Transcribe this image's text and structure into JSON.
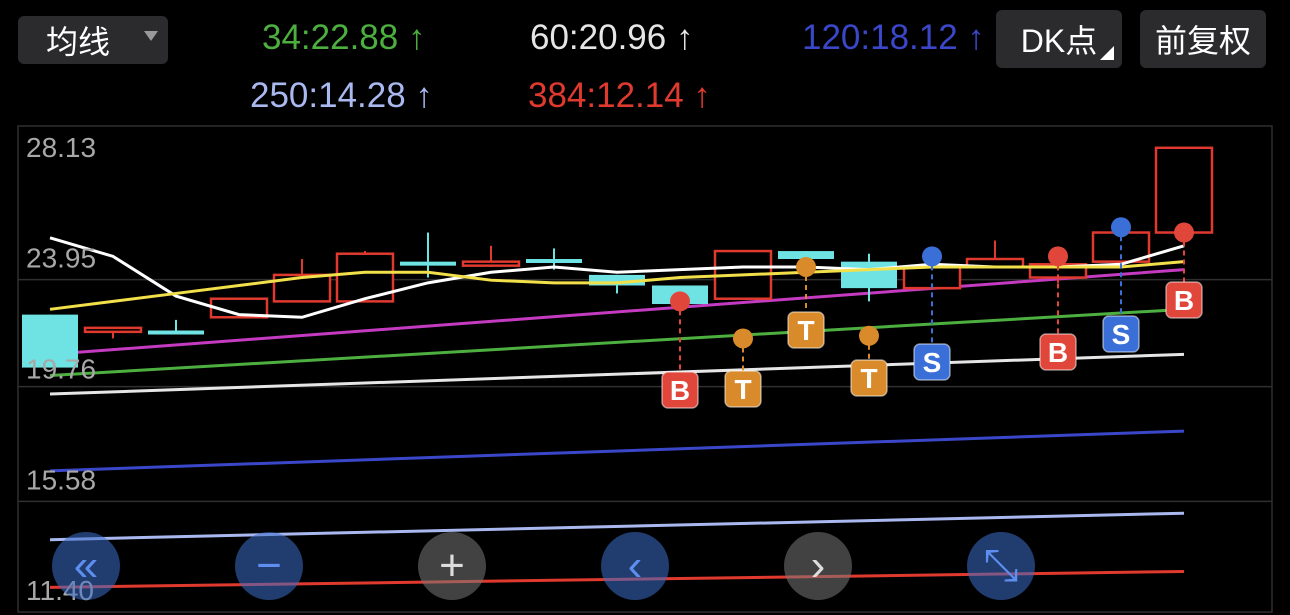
{
  "header": {
    "ma_select_label": "均线",
    "dk_button_label": "DK点",
    "adjust_button_label": "前复权"
  },
  "ma_labels": [
    {
      "text": "34:22.88",
      "arrow": "↑",
      "color": "#4caf3f"
    },
    {
      "text": "60:20.96",
      "arrow": "↑",
      "color": "#e6e6e6"
    },
    {
      "text": "120:18.12",
      "arrow": "↑",
      "color": "#3a47c9"
    },
    {
      "text": "250:14.28",
      "arrow": "↑",
      "color": "#a9b8ef"
    },
    {
      "text": "384:12.14",
      "arrow": "↑",
      "color": "#e03a2f"
    }
  ],
  "chart_data": {
    "type": "candlestick",
    "y_ticks": [
      "28.13",
      "23.95",
      "19.76",
      "15.58",
      "11.40"
    ],
    "ylim": [
      11.4,
      28.13
    ],
    "colors": {
      "up": "#e03a2f",
      "down": "#6fe3e3",
      "grid": "#2f2f2f"
    },
    "candles": [
      {
        "open": 21.8,
        "high": 21.8,
        "low": 19.8,
        "close": 19.8,
        "dir": "down"
      },
      {
        "open": 21.2,
        "high": 21.3,
        "low": 20.9,
        "close": 21.3,
        "dir": "up"
      },
      {
        "open": 21.2,
        "high": 21.6,
        "low": 21.2,
        "close": 21.2,
        "dir": "down"
      },
      {
        "open": 21.7,
        "high": 22.2,
        "low": 21.7,
        "close": 22.4,
        "dir": "up"
      },
      {
        "open": 22.3,
        "high": 23.9,
        "low": 22.3,
        "close": 23.3,
        "dir": "up"
      },
      {
        "open": 22.3,
        "high": 24.2,
        "low": 22.3,
        "close": 24.1,
        "dir": "up"
      },
      {
        "open": 23.8,
        "high": 24.9,
        "low": 23.2,
        "close": 23.8,
        "dir": "down"
      },
      {
        "open": 23.8,
        "high": 24.4,
        "low": 23.6,
        "close": 23.8,
        "dir": "up"
      },
      {
        "open": 23.9,
        "high": 24.3,
        "low": 23.5,
        "close": 23.8,
        "dir": "down"
      },
      {
        "open": 23.3,
        "high": 23.3,
        "low": 22.6,
        "close": 22.9,
        "dir": "down"
      },
      {
        "open": 22.9,
        "high": 22.9,
        "low": 22.0,
        "close": 22.2,
        "dir": "down"
      },
      {
        "open": 22.4,
        "high": 24.2,
        "low": 22.4,
        "close": 24.2,
        "dir": "up"
      },
      {
        "open": 24.2,
        "high": 24.2,
        "low": 23.8,
        "close": 23.9,
        "dir": "down"
      },
      {
        "open": 23.8,
        "high": 24.1,
        "low": 22.3,
        "close": 22.8,
        "dir": "down"
      },
      {
        "open": 22.8,
        "high": 23.6,
        "low": 22.8,
        "close": 23.6,
        "dir": "up"
      },
      {
        "open": 23.6,
        "high": 24.6,
        "low": 23.6,
        "close": 23.9,
        "dir": "up"
      },
      {
        "open": 23.2,
        "high": 24.1,
        "low": 23.0,
        "close": 23.7,
        "dir": "up"
      },
      {
        "open": 23.8,
        "high": 25.2,
        "low": 23.8,
        "close": 24.9,
        "dir": "up"
      },
      {
        "open": 24.9,
        "high": 28.1,
        "low": 24.9,
        "close": 28.1,
        "dir": "up"
      }
    ],
    "ma_series": [
      {
        "name": "white",
        "color": "#ffffff",
        "values": [
          24.7,
          24.0,
          22.5,
          21.8,
          21.7,
          22.4,
          23.0,
          23.4,
          23.6,
          23.4,
          23.5,
          23.6,
          23.6,
          23.5,
          23.7,
          23.6,
          23.6,
          23.7,
          24.4
        ]
      },
      {
        "name": "yellow",
        "color": "#f2e04a",
        "values": [
          22.0,
          22.3,
          22.6,
          22.9,
          23.2,
          23.4,
          23.4,
          23.1,
          23.0,
          23.0,
          23.2,
          23.3,
          23.4,
          23.5,
          23.6,
          23.6,
          23.6,
          23.6,
          23.8
        ]
      }
    ],
    "line_series": [
      {
        "name": "magenta",
        "color": "#c43ac0",
        "start": 20.3,
        "end": 23.5
      },
      {
        "name": "34",
        "color": "#4caf3f",
        "start": 19.5,
        "end": 22.0
      },
      {
        "name": "60",
        "color": "#e6e6e6",
        "start": 18.8,
        "end": 20.3
      },
      {
        "name": "120",
        "color": "#3a47c9",
        "start": 15.9,
        "end": 17.4
      },
      {
        "name": "250",
        "color": "#a9b8ef",
        "start": 13.3,
        "end": 14.3
      },
      {
        "name": "384",
        "color": "#e03a2f",
        "start": 11.5,
        "end": 12.1
      }
    ],
    "signals": [
      {
        "label": "B",
        "index": 10,
        "price": 22.3,
        "color": "#e0463a"
      },
      {
        "label": "T",
        "index": 11,
        "price": 20.9,
        "color": "#d98a2a"
      },
      {
        "label": "T",
        "index": 12,
        "price": 23.6,
        "color": "#d98a2a"
      },
      {
        "label": "T",
        "index": 13,
        "price": 21.0,
        "color": "#d98a2a"
      },
      {
        "label": "S",
        "index": 14,
        "price": 24.0,
        "color": "#3a6fd8"
      },
      {
        "label": "B",
        "index": 16,
        "price": 24.0,
        "color": "#e0463a"
      },
      {
        "label": "S",
        "index": 17,
        "price": 25.1,
        "color": "#3a6fd8"
      },
      {
        "label": "B",
        "index": 18,
        "price": 24.9,
        "color": "#e0463a"
      }
    ]
  },
  "nav_buttons": [
    {
      "name": "rewind-icon",
      "glyph": "«",
      "gray": false
    },
    {
      "name": "zoom-out-icon",
      "glyph": "−",
      "gray": false
    },
    {
      "name": "zoom-in-icon",
      "glyph": "+",
      "gray": true
    },
    {
      "name": "left-icon",
      "glyph": "‹",
      "gray": false
    },
    {
      "name": "right-icon",
      "glyph": "›",
      "gray": true
    },
    {
      "name": "expand-icon",
      "glyph": "⤡",
      "gray": false
    }
  ]
}
